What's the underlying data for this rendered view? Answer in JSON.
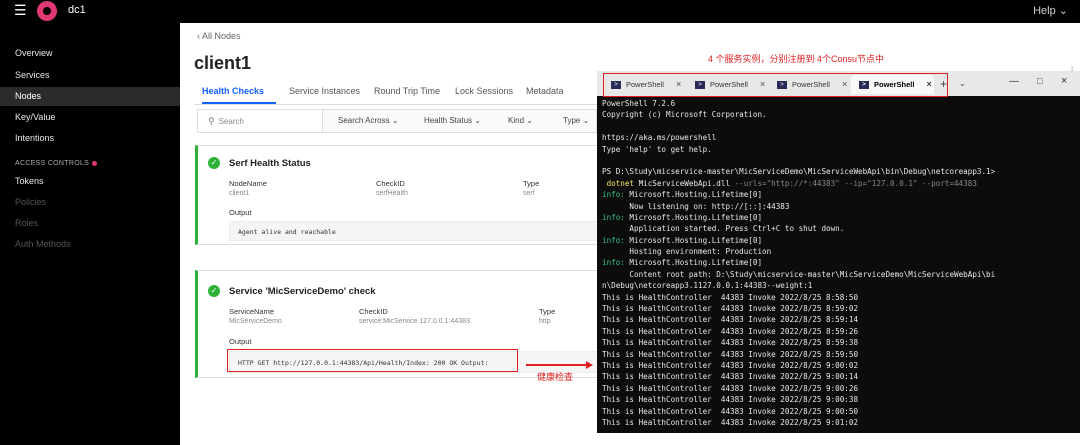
{
  "topbar": {
    "datacenter": "dc1",
    "help": "Help"
  },
  "sidebar": {
    "items": [
      "Overview",
      "Services",
      "Nodes",
      "Key/Value",
      "Intentions"
    ],
    "active": "Nodes",
    "acl_section": "ACCESS CONTROLS",
    "acl_items": [
      "Tokens",
      "Policies",
      "Roles",
      "Auth Methods"
    ]
  },
  "main": {
    "breadcrumb": "All Nodes",
    "title": "client1",
    "tabs": [
      "Health Checks",
      "Service Instances",
      "Round Trip Time",
      "Lock Sessions",
      "Metadata"
    ],
    "filter": {
      "search_placeholder": "Search",
      "search_across": "Search Across",
      "health_status": "Health Status",
      "kind": "Kind",
      "type": "Type"
    },
    "checks": [
      {
        "title": "Serf Health Status",
        "col1_label": "NodeName",
        "col1_value": "client1",
        "col2_label": "CheckID",
        "col2_value": "serfHealth",
        "col3_label": "Type",
        "col3_value": "serf",
        "output_label": "Output",
        "output": "Agent alive and reachable"
      },
      {
        "title": "Service 'MicServiceDemo' check",
        "col1_label": "ServiceName",
        "col1_value": "MicServiceDemo",
        "col2_label": "CheckID",
        "col2_value": "service:MicService 127.0.0.1:44383",
        "col3_label": "Type",
        "col3_value": "http",
        "output_label": "Output",
        "output": "HTTP GET http://127.0.0.1:44383/Api/Health/Index: 200 OK Output:"
      }
    ]
  },
  "annotations": {
    "top": "4 个服务实例，分别注册到 4个Consu节点中",
    "health": "健康检查"
  },
  "powershell": {
    "tabs": [
      "PowerShell",
      "PowerShell",
      "PowerShell",
      "PowerShell"
    ],
    "active_tab": 3,
    "lines": [
      "PowerShell 7.2.6",
      "Copyright (c) Microsoft Corporation.",
      "",
      "https://aka.ms/powershell",
      "Type 'help' to get help.",
      "",
      "PS D:\\Study\\micservice-master\\MicServiceDemo\\MicServiceWebApi\\bin\\Debug\\netcoreapp3.1>",
      " dotnet MicServiceWebApi.dll --urls=\"http://*:44383\" --ip=\"127.0.0.1\" --port=44383",
      "info: Microsoft.Hosting.Lifetime[0]",
      "      Now listening on: http://[::]:44383",
      "info: Microsoft.Hosting.Lifetime[0]",
      "      Application started. Press Ctrl+C to shut down.",
      "info: Microsoft.Hosting.Lifetime[0]",
      "      Hosting environment: Production",
      "info: Microsoft.Hosting.Lifetime[0]",
      "      Content root path: D:\\Study\\micservice-master\\MicServiceDemo\\MicServiceWebApi\\bi",
      "n\\Debug\\netcoreapp3.1127.0.0.1:44383--weight:1",
      "This is HealthController  44383 Invoke 2022/8/25 8:58:50",
      "This is HealthController  44383 Invoke 2022/8/25 8:59:02",
      "This is HealthController  44383 Invoke 2022/8/25 8:59:14",
      "This is HealthController  44383 Invoke 2022/8/25 8:59:26",
      "This is HealthController  44383 Invoke 2022/8/25 8:59:38",
      "This is HealthController  44383 Invoke 2022/8/25 8:59:50",
      "This is HealthController  44383 Invoke 2022/8/25 9:00:02",
      "This is HealthController  44383 Invoke 2022/8/25 9:00:14",
      "This is HealthController  44383 Invoke 2022/8/25 9:00:26",
      "This is HealthController  44383 Invoke 2022/8/25 9:00:38",
      "This is HealthController  44383 Invoke 2022/8/25 9:00:50",
      "This is HealthController  44383 Invoke 2022/8/25 9:01:02"
    ]
  },
  "colors": {
    "accent": "#1563ff",
    "passing": "#2eb039",
    "consul_pink": "#e03875",
    "annotation_red": "#e02020",
    "console_green": "#2ec27e"
  }
}
